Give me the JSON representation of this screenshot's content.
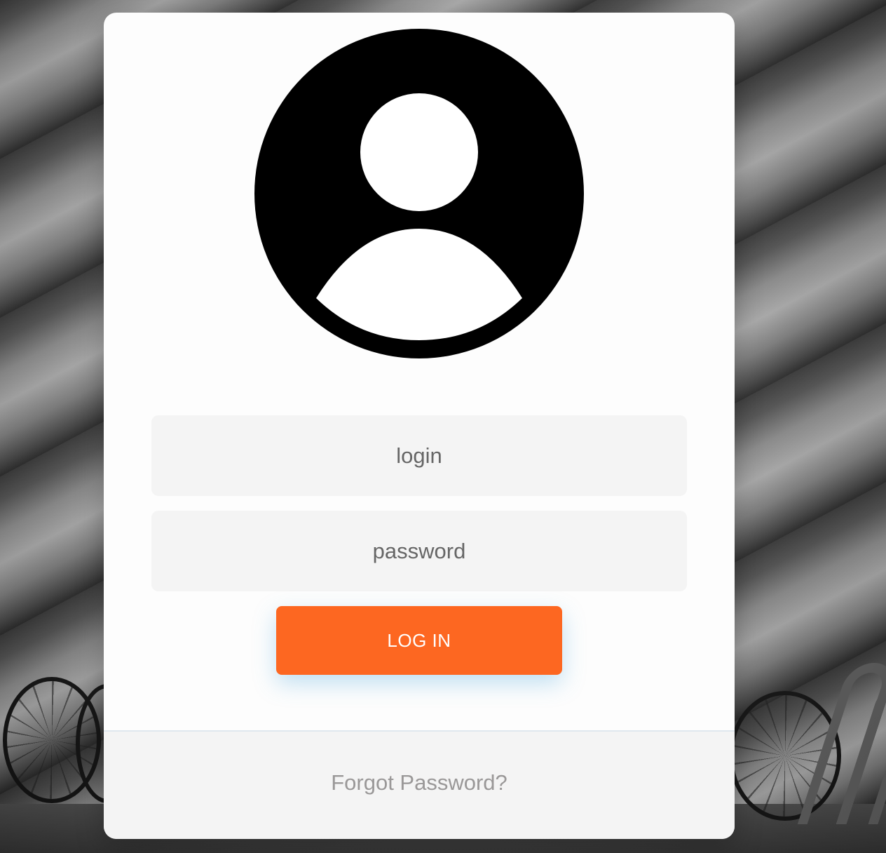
{
  "avatar": {
    "icon": "user-circle-icon"
  },
  "form": {
    "login_placeholder": "login",
    "login_value": "",
    "password_placeholder": "password",
    "password_value": "",
    "submit_label": "LOG IN"
  },
  "footer": {
    "forgot_password_label": "Forgot Password?"
  },
  "colors": {
    "accent": "#fd6721",
    "card_background": "#fdfdfd",
    "field_background": "#f4f4f4",
    "footer_background": "#f4f4f4",
    "link_text": "#9a9898"
  }
}
